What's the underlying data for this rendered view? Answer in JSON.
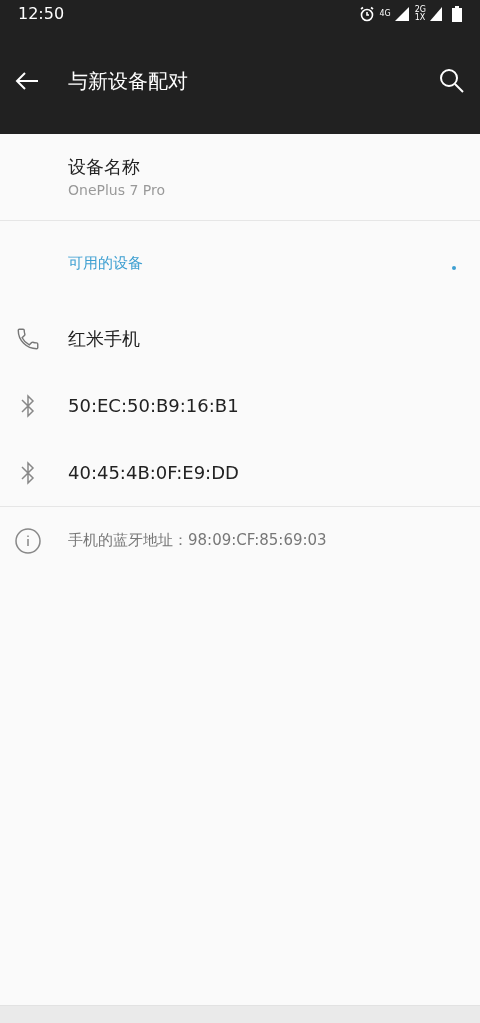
{
  "status_bar": {
    "time": "12:50",
    "network_1": "4G",
    "network_2": "2G",
    "network_3": "1X"
  },
  "toolbar": {
    "title": "与新设备配对"
  },
  "device_name": {
    "label": "设备名称",
    "value": "OnePlus 7 Pro"
  },
  "available": {
    "header": "可用的设备",
    "devices": [
      {
        "kind": "phone",
        "name": "红米手机"
      },
      {
        "kind": "bluetooth",
        "name": "50:EC:50:B9:16:B1"
      },
      {
        "kind": "bluetooth",
        "name": "40:45:4B:0F:E9:DD"
      }
    ]
  },
  "footer": {
    "text": "手机的蓝牙地址：98:09:CF:85:69:03"
  }
}
